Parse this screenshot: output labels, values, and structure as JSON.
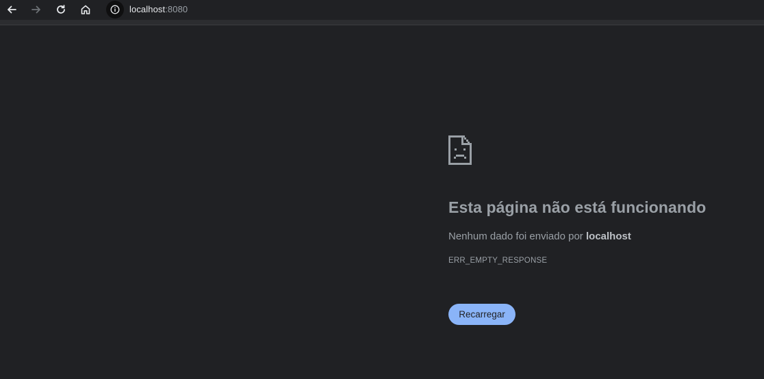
{
  "browser": {
    "url_host": "localhost",
    "url_port": ":8080",
    "icons": [
      "back-arrow-icon",
      "forward-arrow-icon",
      "reload-icon",
      "home-icon",
      "info-icon"
    ]
  },
  "error_page": {
    "icon": "sad-document-icon",
    "title": "Esta página não está funcionando",
    "description_prefix": "Nenhum dado foi enviado por ",
    "description_host": "localhost",
    "error_code": "ERR_EMPTY_RESPONSE",
    "reload_label": "Recarregar"
  },
  "colors": {
    "background": "#202124",
    "text_secondary": "#9aa0a6",
    "button_accent": "#8ab4f8"
  }
}
